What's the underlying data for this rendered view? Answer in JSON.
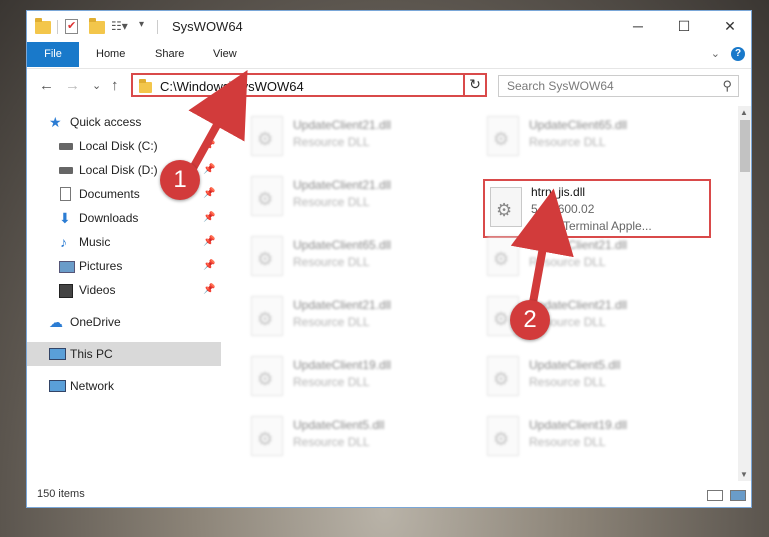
{
  "window": {
    "title": "SysWOW64",
    "controls": {
      "minimize": "─",
      "maximize": "☐",
      "close": "✕"
    }
  },
  "ribbon": {
    "file_tab": "File",
    "tabs": [
      "Home",
      "Share",
      "View"
    ]
  },
  "navigation": {
    "back": "←",
    "forward": "→",
    "recent": "⌄",
    "up": "↑",
    "address": "C:\\Windows\\SysWOW64",
    "search_placeholder": "Search SysWOW64"
  },
  "sidebar": {
    "items": [
      {
        "label": "Quick access",
        "icon": "star-icon"
      },
      {
        "label": "Local Disk (C:)",
        "icon": "drive-icon"
      },
      {
        "label": "Local Disk (D:)",
        "icon": "drive-icon"
      },
      {
        "label": "Documents",
        "icon": "documents-icon"
      },
      {
        "label": "Downloads",
        "icon": "download-icon"
      },
      {
        "label": "Music",
        "icon": "music-icon"
      },
      {
        "label": "Pictures",
        "icon": "pictures-icon"
      },
      {
        "label": "Videos",
        "icon": "videos-icon"
      },
      {
        "label": "OneDrive",
        "icon": "cloud-icon"
      },
      {
        "label": "This PC",
        "icon": "computer-icon",
        "selected": true
      },
      {
        "label": "Network",
        "icon": "network-icon"
      }
    ]
  },
  "files": {
    "left": [
      {
        "name": "UpdateClient21.dll",
        "type": "Resource DLL"
      },
      {
        "name": "UpdateClient21.dll",
        "type": "Resource DLL"
      },
      {
        "name": "UpdateClient65.dll",
        "type": "Resource DLL"
      },
      {
        "name": "UpdateClient21.dll",
        "type": "Resource DLL"
      },
      {
        "name": "UpdateClient19.dll",
        "type": "Resource DLL"
      },
      {
        "name": "UpdateClient5.dll",
        "type": "Resource DLL"
      }
    ],
    "right": [
      {
        "name": "UpdateClient65.dll",
        "type": "Resource DLL"
      },
      {
        "name": "UpdateClient21.dll",
        "type": "Resource DLL"
      },
      {
        "name": "UpdateClient21.dll",
        "type": "Resource DLL"
      },
      {
        "name": "UpdateClient5.dll",
        "type": "Resource DLL"
      },
      {
        "name": "UpdateClient19.dll",
        "type": "Resource DLL"
      }
    ],
    "highlighted": {
      "name": "htrn_jis.dll",
      "version": "5.1.2600.02",
      "description": "HyperTerminal Apple..."
    }
  },
  "status": {
    "item_count": "150 items"
  },
  "callouts": {
    "one": "1",
    "two": "2"
  },
  "colors": {
    "accent": "#1979ca",
    "highlight": "#d94a4a"
  }
}
